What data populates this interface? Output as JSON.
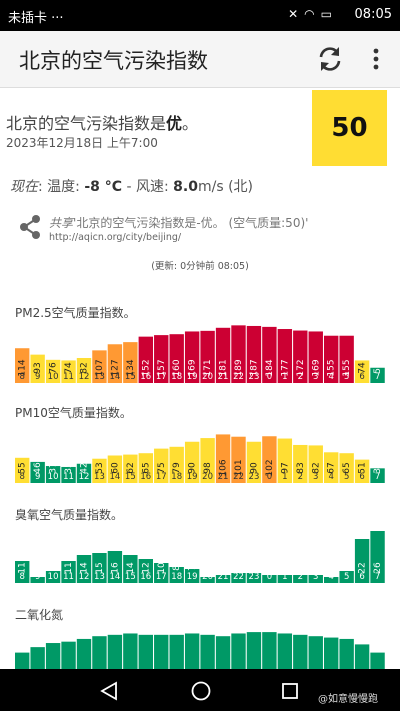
{
  "status_bar": {
    "carrier": "未插卡 ···",
    "time": "08:05"
  },
  "app_bar": {
    "title": "北京的空气污染指数"
  },
  "aqi": {
    "heading_prefix": "北京的空气污染指数是",
    "level": "优",
    "heading_suffix": "。",
    "datetime": "2023年12月18日 上午7:00",
    "value": "50",
    "color": "#ffdd33"
  },
  "weather": {
    "now_label": "现在",
    "temp_label": ": 温度: ",
    "temp_value": "-8 °C",
    "wind_label": " - 风速: ",
    "wind_value": "8.0",
    "wind_unit": "m/s (北)"
  },
  "share": {
    "label": "共享",
    "text": "'北京的空气污染指数是-优。 (空气质量:50)'",
    "url": "http://aqicn.org/city/beijing/"
  },
  "updated": "(更新: 0分钟前 08:05)",
  "watermark": "@如意慢慢跑",
  "hours": [
    "8",
    "9",
    "10",
    "11",
    "12",
    "13",
    "14",
    "15",
    "16",
    "17",
    "18",
    "19",
    "20",
    "21",
    "22",
    "23",
    "0",
    "1",
    "2",
    "3",
    "4",
    "5",
    "6",
    "7"
  ],
  "colors": {
    "good": "#009966",
    "moderate": "#ffde33",
    "sensitive": "#ff9933",
    "unhealthy": "#cc0033"
  },
  "chart_data": [
    {
      "type": "bar",
      "title": "PM2.5空气质量指数。",
      "categories": [
        "8",
        "9",
        "10",
        "11",
        "12",
        "13",
        "14",
        "15",
        "16",
        "17",
        "18",
        "19",
        "20",
        "21",
        "22",
        "23",
        "0",
        "1",
        "2",
        "3",
        "4",
        "5",
        "6",
        "7"
      ],
      "values": [
        114,
        93,
        76,
        74,
        82,
        107,
        127,
        134,
        152,
        157,
        160,
        169,
        171,
        181,
        189,
        187,
        184,
        177,
        172,
        169,
        155,
        155,
        74,
        50
      ],
      "ylim": [
        0,
        200
      ]
    },
    {
      "type": "bar",
      "title": "PM10空气质量指数。",
      "categories": [
        "8",
        "9",
        "10",
        "11",
        "12",
        "13",
        "14",
        "15",
        "16",
        "17",
        "18",
        "19",
        "20",
        "21",
        "22",
        "23",
        "0",
        "1",
        "2",
        "3",
        "4",
        "5",
        "6",
        "7"
      ],
      "values": [
        55,
        46,
        37,
        35,
        42,
        53,
        60,
        62,
        65,
        75,
        79,
        90,
        98,
        106,
        101,
        90,
        102,
        97,
        83,
        82,
        67,
        65,
        51,
        32
      ],
      "ylim": [
        0,
        120
      ]
    },
    {
      "type": "bar",
      "title": "臭氧空气质量指数。",
      "categories": [
        "8",
        "9",
        "10",
        "11",
        "12",
        "13",
        "14",
        "15",
        "16",
        "17",
        "18",
        "19",
        "20",
        "21",
        "22",
        "23",
        "0",
        "1",
        "2",
        "3",
        "4",
        "5",
        "6",
        "7"
      ],
      "values": [
        11,
        3,
        6,
        11,
        14,
        15,
        16,
        14,
        12,
        10,
        8,
        7,
        3,
        4,
        5,
        5,
        4,
        4,
        4,
        4,
        3,
        6,
        22,
        26
      ],
      "ylim": [
        0,
        30
      ]
    },
    {
      "type": "bar",
      "title": "二氧化氮",
      "categories": [
        "8",
        "9",
        "10",
        "11",
        "12",
        "13",
        "14",
        "15",
        "16",
        "17",
        "18",
        "19",
        "20",
        "21",
        "22",
        "23",
        "0",
        "1",
        "2",
        "3",
        "4",
        "5",
        "6",
        "7"
      ],
      "values": [
        12,
        16,
        19,
        20,
        22,
        24,
        25,
        26,
        25,
        25,
        25,
        26,
        25,
        24,
        26,
        27,
        27,
        26,
        25,
        24,
        23,
        22,
        18,
        12
      ],
      "ylim": [
        0,
        30
      ]
    }
  ]
}
